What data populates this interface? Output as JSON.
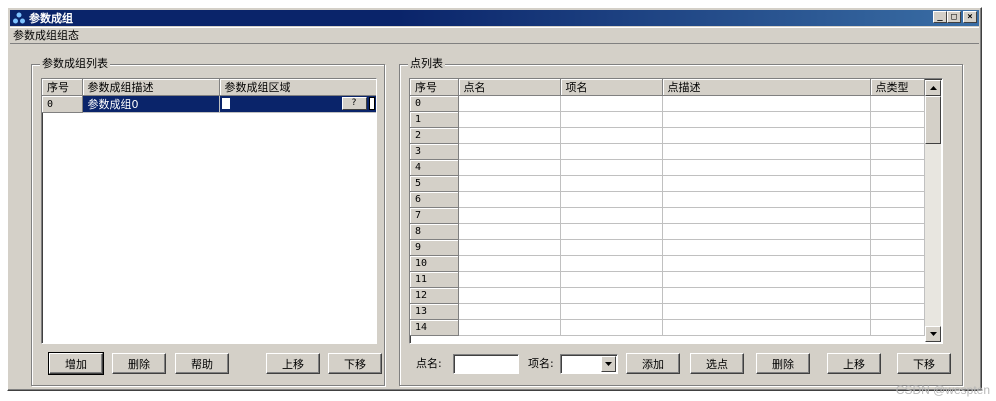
{
  "window": {
    "title": "参数成组"
  },
  "tab": {
    "label": "参数成组组态"
  },
  "left_group": {
    "label": "参数成组列表",
    "headers": [
      "序号",
      "参数成组描述",
      "参数成组区域"
    ],
    "rows": [
      {
        "index": "0",
        "desc": "参数成组0",
        "area_button": "?"
      }
    ],
    "buttons": {
      "add": "增加",
      "delete": "删除",
      "help": "帮助",
      "up": "上移",
      "down": "下移"
    }
  },
  "right_group": {
    "label": "点列表",
    "headers": [
      "序号",
      "点名",
      "项名",
      "点描述",
      "点类型"
    ],
    "rows": [
      "0",
      "1",
      "2",
      "3",
      "4",
      "5",
      "6",
      "7",
      "8",
      "9",
      "10",
      "11",
      "12",
      "13",
      "14"
    ],
    "point_name_label": "点名:",
    "point_name_value": "",
    "item_name_label": "项名:",
    "item_name_value": "",
    "buttons": {
      "add": "添加",
      "select": "选点",
      "delete": "删除",
      "up": "上移",
      "down": "下移"
    }
  },
  "watermark": "CSDN @wespten",
  "icons": {
    "app": "app-icon",
    "minimize": "minimize-icon",
    "restore": "restore-icon",
    "close": "close-icon"
  }
}
